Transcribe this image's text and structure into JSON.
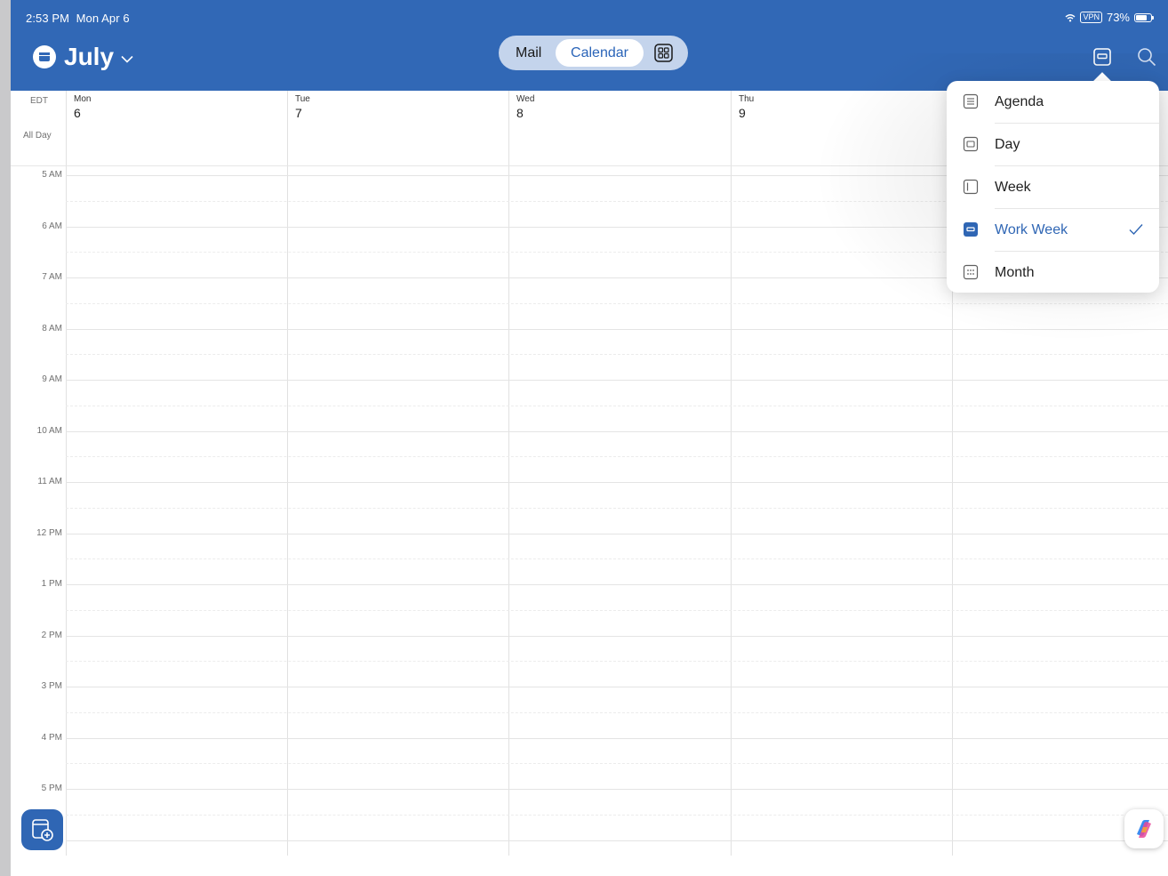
{
  "status_bar": {
    "time": "2:53 PM",
    "date": "Mon Apr 6",
    "vpn": "VPN",
    "battery": "73%"
  },
  "header": {
    "month": "July",
    "calendar_icon": "calendar-icon",
    "chevron_icon": "chevron-down-icon"
  },
  "switcher": {
    "mail": "Mail",
    "calendar": "Calendar",
    "apps_icon": "apps-grid-icon"
  },
  "toolbar": {
    "view_icon": "work-week-view-icon",
    "search_icon": "search-icon"
  },
  "gutter": {
    "timezone": "EDT",
    "all_day": "All Day"
  },
  "days": [
    {
      "name": "Mon",
      "num": "6"
    },
    {
      "name": "Tue",
      "num": "7"
    },
    {
      "name": "Wed",
      "num": "8"
    },
    {
      "name": "Thu",
      "num": "9"
    }
  ],
  "hours": [
    "5 AM",
    "6 AM",
    "7 AM",
    "8 AM",
    "9 AM",
    "10 AM",
    "11 AM",
    "12 PM",
    "1 PM",
    "2 PM",
    "3 PM",
    "4 PM",
    "5 PM"
  ],
  "view_menu": {
    "items": [
      {
        "label": "Agenda",
        "icon": "agenda-view-icon",
        "selected": false
      },
      {
        "label": "Day",
        "icon": "day-view-icon",
        "selected": false
      },
      {
        "label": "Week",
        "icon": "week-view-icon",
        "selected": false
      },
      {
        "label": "Work Week",
        "icon": "work-week-view-icon",
        "selected": true
      },
      {
        "label": "Month",
        "icon": "month-view-icon",
        "selected": false
      }
    ]
  },
  "fab": {
    "new_event_icon": "new-event-icon",
    "copilot_icon": "copilot-icon"
  },
  "colors": {
    "brand": "#3168b6",
    "selected": "#2f66b4"
  }
}
